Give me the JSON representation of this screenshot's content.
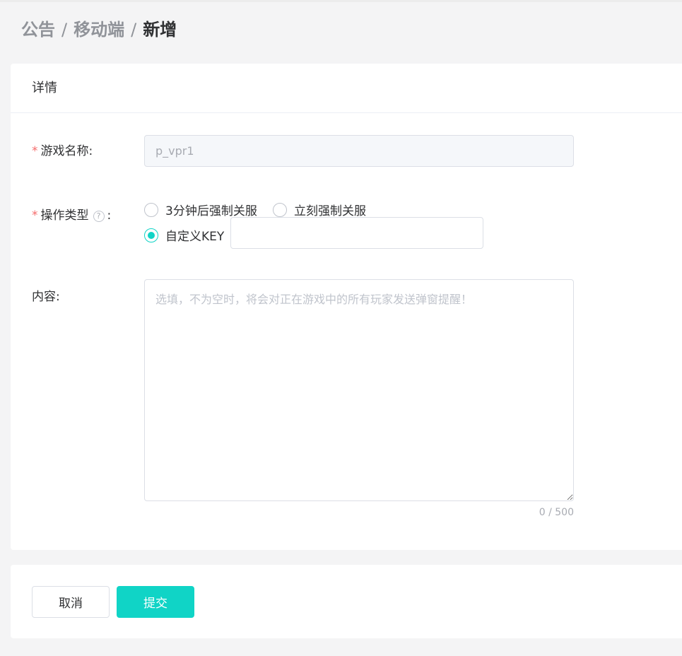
{
  "breadcrumb": {
    "items": [
      "公告",
      "移动端"
    ],
    "separator": "/",
    "current": "新增"
  },
  "card": {
    "title": "详情"
  },
  "form": {
    "game_name": {
      "label": "游戏名称:",
      "required_mark": "*",
      "value": "p_vpr1",
      "disabled": true
    },
    "operation_type": {
      "label_text": "操作类型",
      "label_colon": ":",
      "help_icon": "question-circle-icon",
      "help_glyph": "?",
      "required_mark": "*",
      "options": [
        {
          "label": "3分钟后强制关服",
          "checked": false
        },
        {
          "label": "立刻强制关服",
          "checked": false
        },
        {
          "label": "自定义KEY",
          "checked": true
        }
      ],
      "custom_key_value": ""
    },
    "content": {
      "label": "内容:",
      "placeholder": "选填，不为空时，将会对正在游戏中的所有玩家发送弹窗提醒！",
      "value": "",
      "counter": "0 / 500"
    }
  },
  "footer": {
    "cancel_label": "取消",
    "submit_label": "提交"
  },
  "colors": {
    "accent": "#10d4c6",
    "required": "#f56c6c",
    "page_bg": "#f4f4f5"
  }
}
